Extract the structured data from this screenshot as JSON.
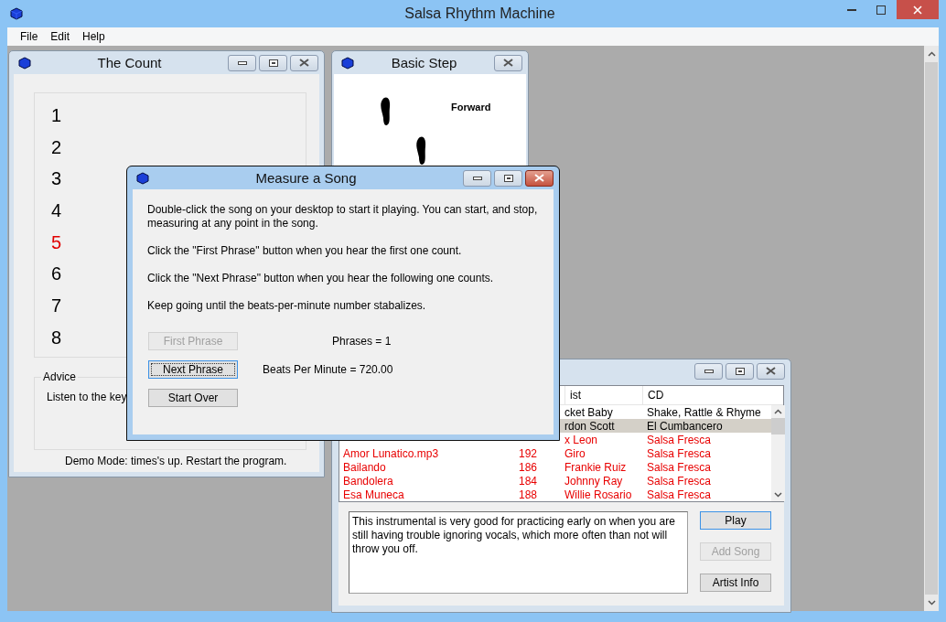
{
  "window": {
    "title": "Salsa Rhythm Machine"
  },
  "menu": [
    "File",
    "Edit",
    "Help"
  ],
  "count_window": {
    "title": "The Count",
    "counts": [
      {
        "label": "1",
        "selected": false
      },
      {
        "label": "2",
        "selected": false
      },
      {
        "label": "3",
        "selected": false
      },
      {
        "label": "4",
        "selected": false
      },
      {
        "label": "5",
        "selected": true
      },
      {
        "label": "6",
        "selected": false
      },
      {
        "label": "7",
        "selected": false
      },
      {
        "label": "8",
        "selected": false
      }
    ],
    "advice": {
      "legend": "Advice",
      "text": "Listen to the key"
    },
    "status": "Demo Mode: times's up. Restart the program."
  },
  "step_window": {
    "title": "Basic Step",
    "direction": "Forward"
  },
  "songs_window": {
    "table": {
      "columns": [
        "ist",
        "CD"
      ],
      "rows": [
        {
          "artist": "cket Baby",
          "cd": "Shake, Rattle & Rhyme",
          "selected": false,
          "red": false
        },
        {
          "artist": "rdon Scott",
          "cd": "El Cumbancero",
          "selected": true,
          "red": false
        },
        {
          "artist": "x Leon",
          "cd": "Salsa Fresca",
          "selected": false,
          "red": true
        },
        {
          "song": "Amor Lunatico.mp3",
          "bpm": "192",
          "artist": "Giro",
          "cd": "Salsa Fresca",
          "selected": false,
          "red": true
        },
        {
          "song": "Bailando",
          "bpm": "186",
          "artist": "Frankie Ruiz",
          "cd": "Salsa Fresca",
          "selected": false,
          "red": true
        },
        {
          "song": "Bandolera",
          "bpm": "184",
          "artist": "Johnny Ray",
          "cd": "Salsa Fresca",
          "selected": false,
          "red": true
        },
        {
          "song": "Esa Muneca",
          "bpm": "188",
          "artist": "Willie Rosario",
          "cd": "Salsa Fresca",
          "selected": false,
          "red": true
        }
      ]
    },
    "notes": "This instrumental is very good for practicing early on when you are still having trouble ignoring vocals, which more often than not will throw you off.",
    "buttons": [
      {
        "label": "Play",
        "disabled": false,
        "focused": true
      },
      {
        "label": "Add Song",
        "disabled": true,
        "focused": false
      },
      {
        "label": "Artist Info",
        "disabled": false,
        "focused": false
      }
    ]
  },
  "measure_dialog": {
    "title": "Measure a Song",
    "paragraphs": [
      "Double-click the song on your desktop to start it playing. You can start, and stop, measuring at any point in the song.",
      "Click the \"First Phrase\" button when you hear the first one count.",
      "Click the \"Next Phrase\" button when you hear the following one counts.",
      "Keep going until the beats-per-minute number stabalizes."
    ],
    "buttons": [
      {
        "label": "First Phrase",
        "disabled": true,
        "focused": false
      },
      {
        "label": "Next Phrase",
        "disabled": false,
        "focused": true
      },
      {
        "label": "Start Over",
        "disabled": false,
        "focused": false
      }
    ],
    "readouts": [
      "Phrases = 1",
      "Beats Per Minute = 720.00"
    ]
  }
}
